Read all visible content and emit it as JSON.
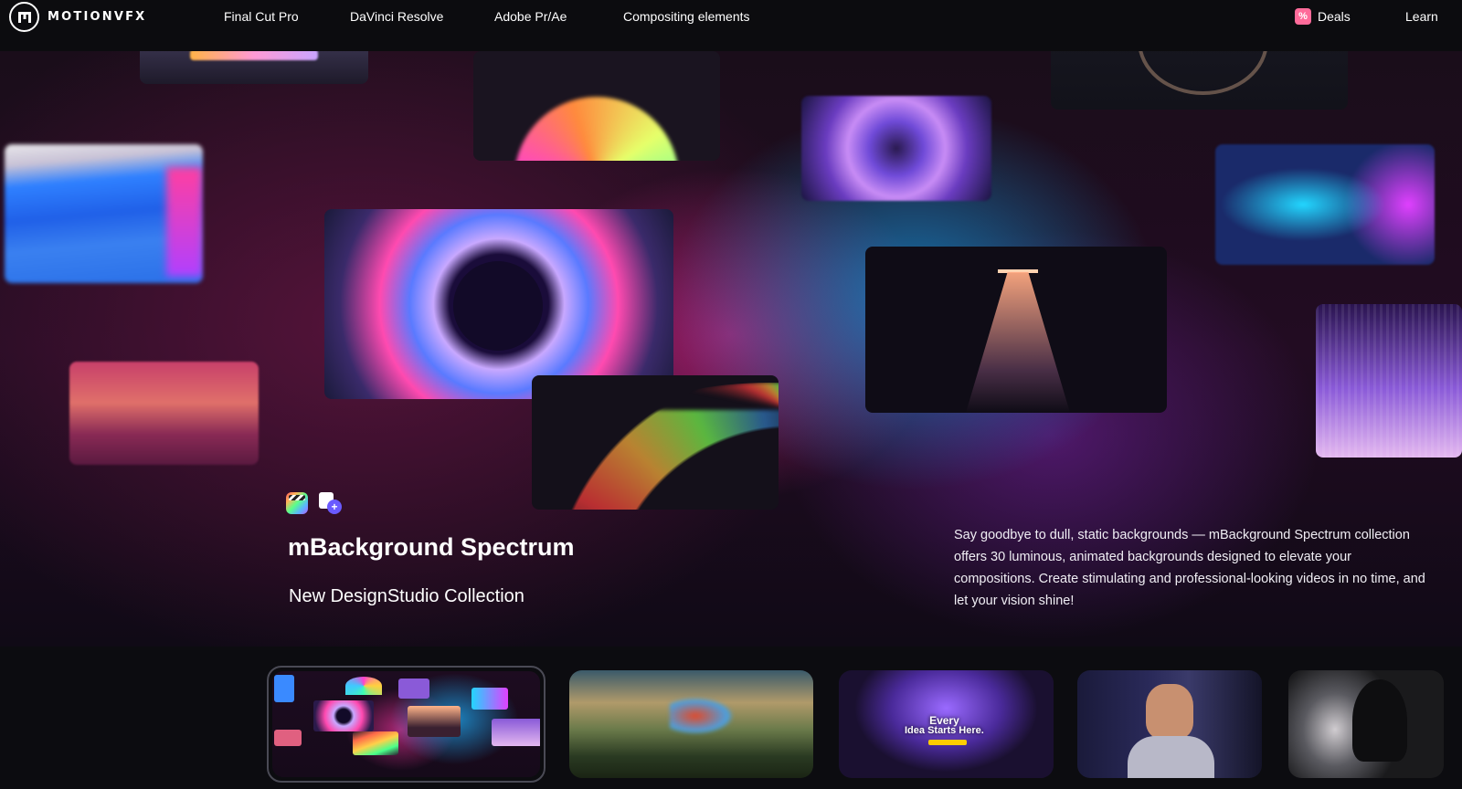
{
  "nav": {
    "logo_text": "MOTIONVFX",
    "links": [
      "Final Cut Pro",
      "DaVinci Resolve",
      "Adobe Pr/Ae",
      "Compositing elements"
    ],
    "deals_icon": "%",
    "deals_label": "Deals",
    "learn_label": "Learn"
  },
  "hero": {
    "product_icons": [
      "final-cut-pro-icon",
      "designstudio-icon"
    ],
    "title": "mBackground Spectrum",
    "subtitle": "New DesignStudio Collection",
    "description": "Say goodbye to dull, static backgrounds — mBackground Spectrum collection offers 30 luminous, animated backgrounds designed to elevate your compositions. Create stimulating and professional-looking videos in no time, and let your vision shine!"
  },
  "thumbnails": {
    "t3_line1": "Every",
    "t3_line2": "Idea Starts Here."
  },
  "colors": {
    "nav_bg": "#0c0c0f",
    "deals_accent": "#ff6b9a",
    "page_bg": "#0a0a0d"
  }
}
